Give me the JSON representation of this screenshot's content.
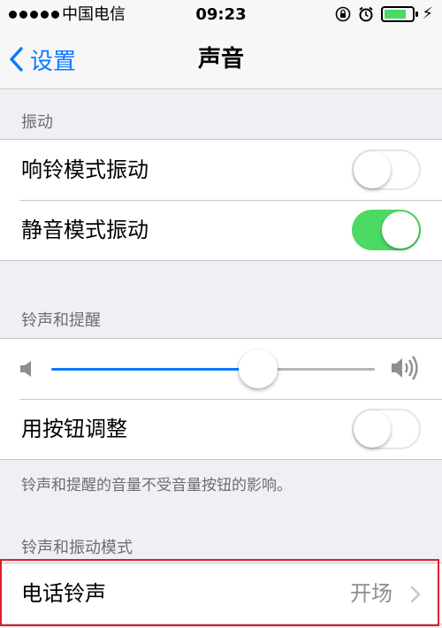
{
  "status_bar": {
    "carrier": "中国电信",
    "time": "09:23",
    "signal_bars": 5,
    "battery_level": 0.7,
    "icons": [
      "orientation-lock-icon",
      "alarm-icon",
      "battery-icon",
      "charging-bolt-icon"
    ]
  },
  "nav": {
    "back_label": "设置",
    "title": "声音"
  },
  "sections": {
    "vibrate": {
      "header": "振动",
      "ring_vibrate": {
        "label": "响铃模式振动",
        "on": false
      },
      "silent_vibrate": {
        "label": "静音模式振动",
        "on": true
      }
    },
    "ringer": {
      "header": "铃声和提醒",
      "volume_level": 0.64,
      "change_with_buttons": {
        "label": "用按钮调整",
        "on": false
      },
      "footer": "铃声和提醒的音量不受音量按钮的影响。"
    },
    "patterns": {
      "header": "铃声和振动模式",
      "ringtone": {
        "label": "电话铃声",
        "value": "开场"
      }
    }
  },
  "colors": {
    "accent": "#0a7aff",
    "toggle_on": "#4cd964",
    "highlight": "#d9202a",
    "background": "#efeff4"
  }
}
